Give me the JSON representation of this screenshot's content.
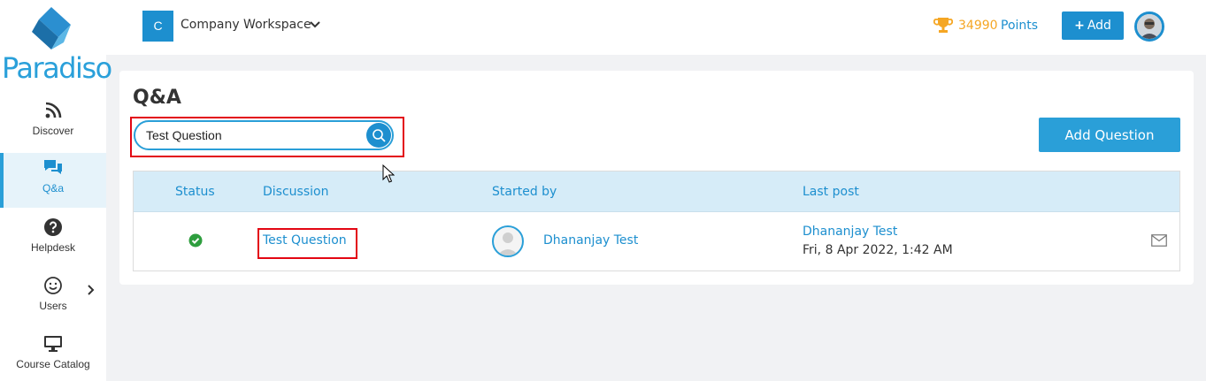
{
  "brand": {
    "name": "Paradiso",
    "color": "#2aa0da"
  },
  "sidebar": {
    "items": [
      {
        "label": "Discover",
        "icon": "rss-icon"
      },
      {
        "label": "Q&a",
        "icon": "chat-icon",
        "active": true
      },
      {
        "label": "Helpdesk",
        "icon": "help-circle-icon"
      },
      {
        "label": "Users",
        "icon": "smiley-icon",
        "has_submenu": true
      },
      {
        "label": "Course Catalog",
        "icon": "monitor-icon"
      }
    ]
  },
  "header": {
    "workspace_initial": "C",
    "workspace_name": "Company Workspace",
    "points_value": "34990",
    "points_label": "Points",
    "add_label": "Add"
  },
  "main": {
    "title": "Q&A",
    "search": {
      "value": "Test Question"
    },
    "add_question_label": "Add Question",
    "table": {
      "columns": [
        "Status",
        "Discussion",
        "Started by",
        "Last post"
      ],
      "rows": [
        {
          "status": "answered",
          "discussion": "Test Question",
          "started_by": "Dhananjay Test",
          "last_post_user": "Dhananjay Test",
          "last_post_date": "Fri, 8 Apr 2022, 1:42 AM"
        }
      ]
    }
  },
  "colors": {
    "accent": "#1d8fcf",
    "highlight": "#e30613",
    "points": "#f5a623",
    "success": "#2e9e3e"
  }
}
